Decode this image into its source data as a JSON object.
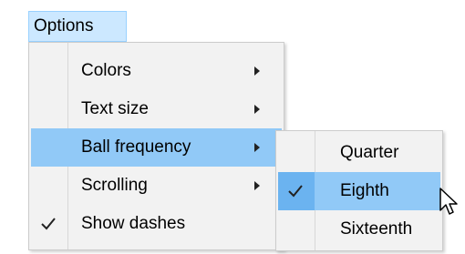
{
  "menubar": {
    "options_label": "Options"
  },
  "main_menu": {
    "items": [
      {
        "label": "Colors",
        "has_submenu": true
      },
      {
        "label": "Text size",
        "has_submenu": true
      },
      {
        "label": "Ball frequency",
        "has_submenu": true,
        "highlighted": true
      },
      {
        "label": "Scrolling",
        "has_submenu": true
      },
      {
        "label": "Show dashes",
        "checked": true
      }
    ]
  },
  "submenu": {
    "parent": "Ball frequency",
    "items": [
      {
        "label": "Quarter"
      },
      {
        "label": "Eighth",
        "checked": true,
        "highlighted": true
      },
      {
        "label": "Sixteenth"
      }
    ]
  },
  "colors": {
    "highlight": "#91c9f7",
    "menu_bg": "#f2f2f2",
    "menubar_active": "#cce8ff"
  }
}
